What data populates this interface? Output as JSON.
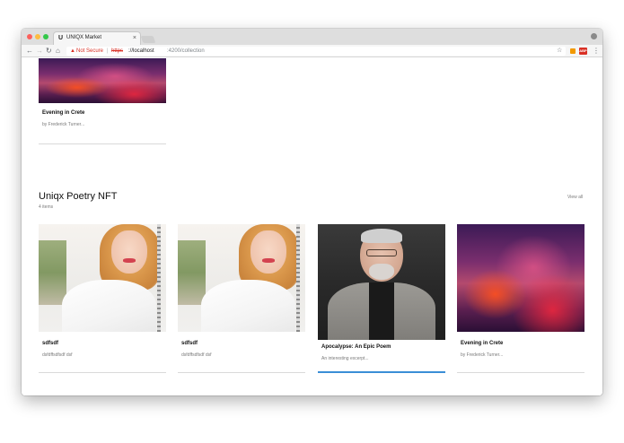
{
  "browser": {
    "tab_title": "UNIQX Market",
    "tab_favicon": "U",
    "tab_close": "×",
    "security_label": "Not Secure",
    "url_separator": "|",
    "url_scheme": "https",
    "url_host": "://localhost",
    "url_path": ":4200/collection",
    "ext_badge": "ABP"
  },
  "top_card": {
    "title": "Evening in Crete",
    "subtitle": "by Frederick Turner..."
  },
  "section": {
    "title": "Uniqx Poetry NFT",
    "count": "4 items",
    "view_all": "View all"
  },
  "cards": [
    {
      "title": "sdfsdf",
      "subtitle": "dsfdffsdfsdf dsf"
    },
    {
      "title": "sdfsdf",
      "subtitle": "dsfdffsdfsdf dsf"
    },
    {
      "title": "Apocalypse: An Epic Poem",
      "subtitle": "An interesting excerpt..."
    },
    {
      "title": "Evening in Crete",
      "subtitle": "by Frederick Turner..."
    }
  ],
  "colors": {
    "accent": "#3b8ed6",
    "warning": "#d93025"
  }
}
